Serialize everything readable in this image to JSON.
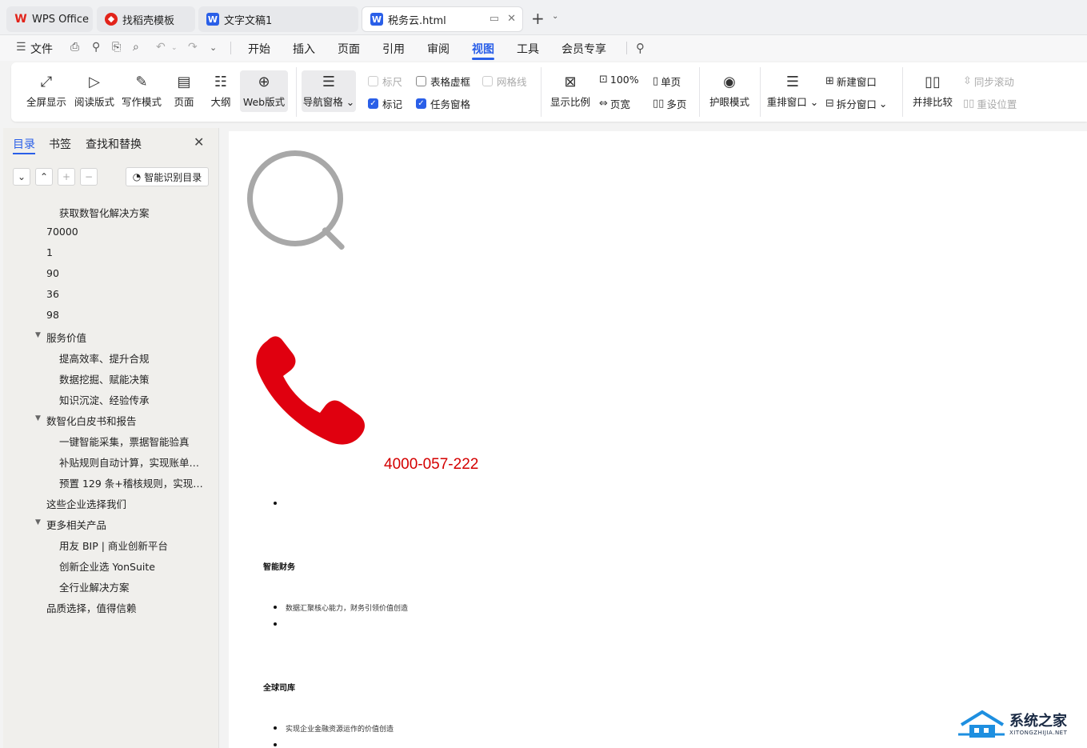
{
  "tabs": [
    {
      "label": "WPS Office"
    },
    {
      "label": "找稻壳模板"
    },
    {
      "label": "文字文稿1"
    },
    {
      "label": "税务云.html"
    }
  ],
  "menubar": {
    "file": "文件",
    "items": [
      "开始",
      "插入",
      "页面",
      "引用",
      "审阅",
      "视图",
      "工具",
      "会员专享"
    ],
    "active": "视图"
  },
  "ribbon": {
    "fullscreen": "全屏显示",
    "reading": "阅读版式",
    "writing": "写作模式",
    "page": "页面",
    "outline": "大纲",
    "web": "Web版式",
    "nav_pane": "导航窗格",
    "ruler": "标尺",
    "table_grid": "表格虚框",
    "gridlines": "网格线",
    "markup": "标记",
    "task_pane": "任务窗格",
    "zoom": "显示比例",
    "zoom_100": "100%",
    "page_width": "页宽",
    "single_page": "单页",
    "multi_page": "多页",
    "eye_care": "护眼模式",
    "rearrange": "重排窗口",
    "new_window": "新建窗口",
    "split_window": "拆分窗口",
    "side_by_side": "并排比较",
    "sync_scroll": "同步滚动",
    "reset_position": "重设位置"
  },
  "panel": {
    "tabs": [
      "目录",
      "书签",
      "查找和替换"
    ],
    "smart_button": "智能识别目录",
    "toc": [
      {
        "text": "获取数智化解决方案",
        "level": 2
      },
      {
        "text": "70000",
        "level": 1
      },
      {
        "text": "1",
        "level": 1
      },
      {
        "text": "90",
        "level": 1
      },
      {
        "text": "36",
        "level": 1
      },
      {
        "text": "98",
        "level": 1
      },
      {
        "text": "服务价值",
        "level": 1,
        "expanded": true
      },
      {
        "text": "提高效率、提升合规",
        "level": 2
      },
      {
        "text": "数据挖掘、赋能决策",
        "level": 2
      },
      {
        "text": "知识沉淀、经验传承",
        "level": 2
      },
      {
        "text": "数智化白皮书和报告",
        "level": 1,
        "expanded": true
      },
      {
        "text": "一键智能采集，票据智能验真",
        "level": 2
      },
      {
        "text": "补贴规则自动计算，实现账单…",
        "level": 2
      },
      {
        "text": "预置 129 条+稽核规则，实现…",
        "level": 2
      },
      {
        "text": "这些企业选择我们",
        "level": 1
      },
      {
        "text": "更多相关产品",
        "level": 1,
        "expanded": true
      },
      {
        "text": "用友 BIP | 商业创新平台",
        "level": 2
      },
      {
        "text": "创新企业选 YonSuite",
        "level": 2
      },
      {
        "text": "全行业解决方案",
        "level": 2
      },
      {
        "text": "品质选择，值得信赖",
        "level": 1
      }
    ]
  },
  "document": {
    "phone": "4000-057-222",
    "heading1": "智能财务",
    "text1": "数据汇聚核心能力，财务引领价值创造",
    "heading2": "全球司库",
    "text2": "实现企业金融资源运作的价值创造",
    "phone_color": "#d40000"
  },
  "watermark": {
    "title": "系统之家",
    "sub": "XITONGZHIJIA.NET"
  },
  "colors": {
    "accent": "#2a5fe8",
    "wps_red": "#e2231a"
  }
}
